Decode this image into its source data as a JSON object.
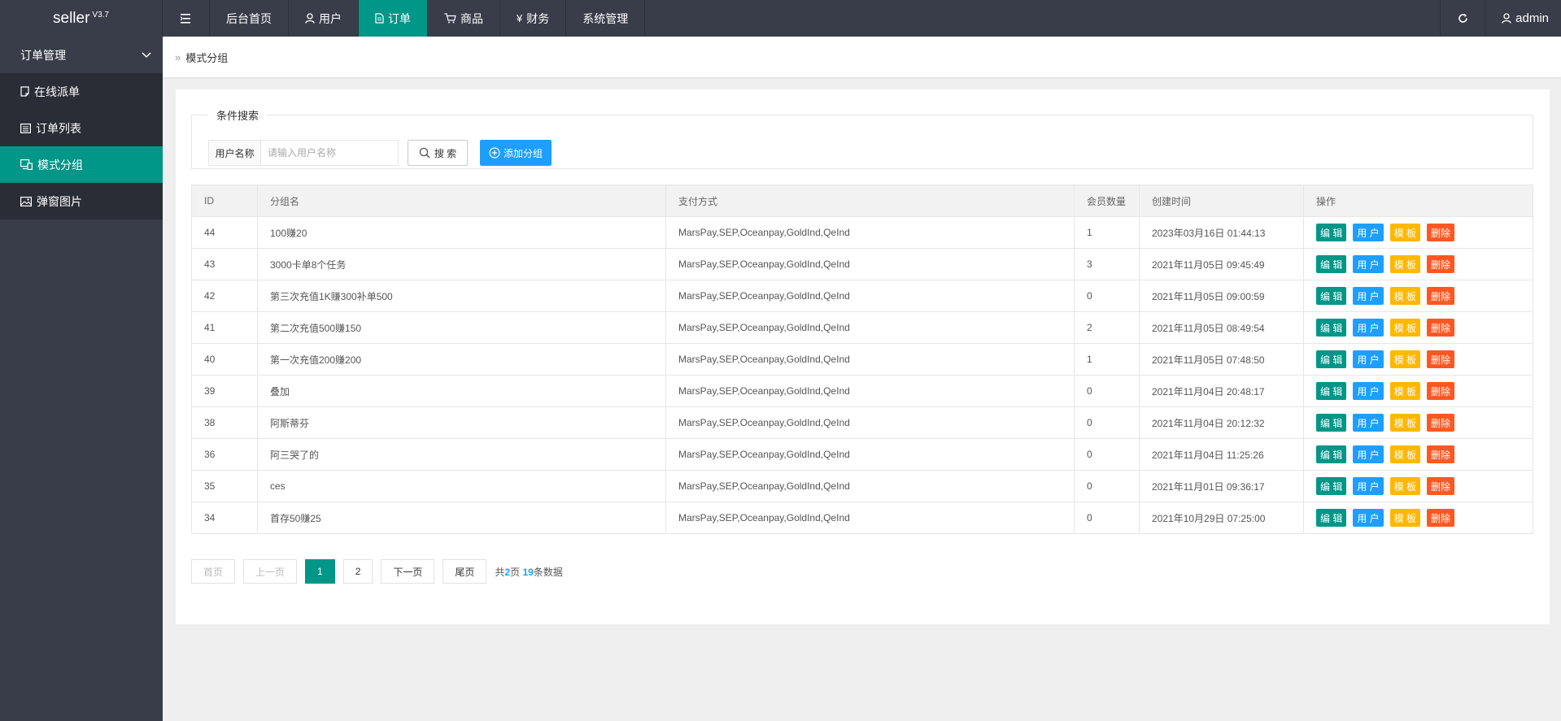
{
  "colors": {
    "topbar": "#393d49",
    "accent": "#009688",
    "blue": "#1e9fff",
    "orange": "#ffb800",
    "red": "#ff5722"
  },
  "header": {
    "logo": "seller",
    "version": "V3.7",
    "nav": [
      {
        "label": "后台首页"
      },
      {
        "label": "用户",
        "icon": "user-icon"
      },
      {
        "label": "订单",
        "icon": "document-icon",
        "active": true
      },
      {
        "label": "商品",
        "icon": "cart-icon"
      },
      {
        "label": "财务",
        "icon": "yen-icon"
      },
      {
        "label": "系统管理"
      }
    ],
    "user": "admin"
  },
  "sidebar": {
    "group": "订单管理",
    "items": [
      {
        "label": "在线派单",
        "icon": "note-icon"
      },
      {
        "label": "订单列表",
        "icon": "list-icon"
      },
      {
        "label": "模式分组",
        "icon": "monitor-icon",
        "active": true
      },
      {
        "label": "弹窗图片",
        "icon": "image-icon"
      }
    ]
  },
  "breadcrumb": "模式分组",
  "search": {
    "legend": "条件搜索",
    "label": "用户名称",
    "placeholder": "请输入用户名称",
    "search_btn": "搜 索",
    "add_btn": "添加分组"
  },
  "table": {
    "columns": [
      "ID",
      "分组名",
      "支付方式",
      "会员数量",
      "创建时间",
      "操作"
    ],
    "actions": [
      "编 辑",
      "用 户",
      "模 板",
      "删除"
    ],
    "rows": [
      {
        "id": "44",
        "name": "100赚20",
        "pay": "MarsPay,SEP,Oceanpay,GoldInd,QeInd",
        "count": "1",
        "time": "2023年03月16日 01:44:13"
      },
      {
        "id": "43",
        "name": "3000卡单8个任务",
        "pay": "MarsPay,SEP,Oceanpay,GoldInd,QeInd",
        "count": "3",
        "time": "2021年11月05日 09:45:49"
      },
      {
        "id": "42",
        "name": "第三次充值1K赚300补单500",
        "pay": "MarsPay,SEP,Oceanpay,GoldInd,QeInd",
        "count": "0",
        "time": "2021年11月05日 09:00:59"
      },
      {
        "id": "41",
        "name": "第二次充值500赚150",
        "pay": "MarsPay,SEP,Oceanpay,GoldInd,QeInd",
        "count": "2",
        "time": "2021年11月05日 08:49:54"
      },
      {
        "id": "40",
        "name": "第一次充值200赚200",
        "pay": "MarsPay,SEP,Oceanpay,GoldInd,QeInd",
        "count": "1",
        "time": "2021年11月05日 07:48:50"
      },
      {
        "id": "39",
        "name": "叠加",
        "pay": "MarsPay,SEP,Oceanpay,GoldInd,QeInd",
        "count": "0",
        "time": "2021年11月04日 20:48:17"
      },
      {
        "id": "38",
        "name": "阿斯蒂芬",
        "pay": "MarsPay,SEP,Oceanpay,GoldInd,QeInd",
        "count": "0",
        "time": "2021年11月04日 20:12:32"
      },
      {
        "id": "36",
        "name": "阿三哭了的",
        "pay": "MarsPay,SEP,Oceanpay,GoldInd,QeInd",
        "count": "0",
        "time": "2021年11月04日 11:25:26"
      },
      {
        "id": "35",
        "name": "ces",
        "pay": "MarsPay,SEP,Oceanpay,GoldInd,QeInd",
        "count": "0",
        "time": "2021年11月01日 09:36:17"
      },
      {
        "id": "34",
        "name": "首存50赚25",
        "pay": "MarsPay,SEP,Oceanpay,GoldInd,QeInd",
        "count": "0",
        "time": "2021年10月29日 07:25:00"
      }
    ]
  },
  "pager": {
    "first": "首页",
    "prev": "上一页",
    "pages": [
      "1",
      "2"
    ],
    "current": "1",
    "next": "下一页",
    "last": "尾页",
    "info_prefix": "共",
    "total_pages": "2",
    "info_mid": "页 ",
    "total_items": "19",
    "info_suffix": "条数据"
  }
}
